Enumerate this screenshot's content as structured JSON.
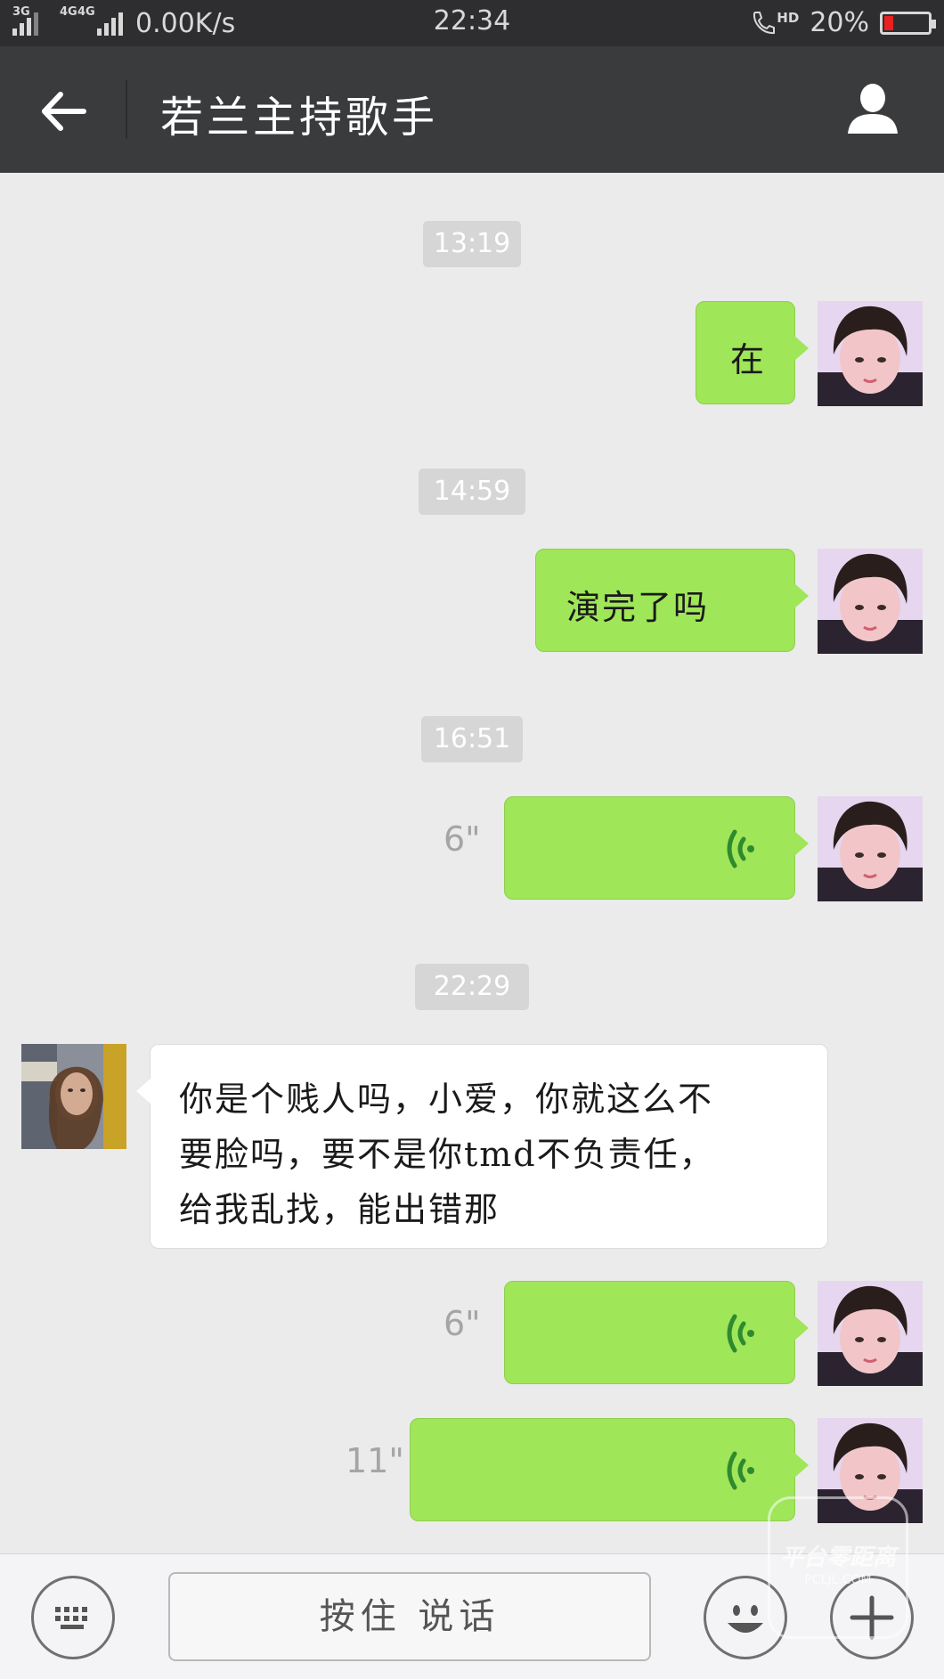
{
  "status_bar": {
    "net1": "3G",
    "net2": "4G",
    "net3": "4G",
    "speed": "0.00K/s",
    "time": "22:34",
    "call_label": "HD",
    "battery": "20%",
    "battery_level": 0.2,
    "battery_color": "#e82020"
  },
  "header": {
    "title": "若兰主持歌手"
  },
  "messages": [
    {
      "type": "timestamp",
      "text": "13:19"
    },
    {
      "type": "text",
      "sender": "me",
      "text": "在"
    },
    {
      "type": "timestamp",
      "text": "14:59"
    },
    {
      "type": "text",
      "sender": "me",
      "text": "演完了吗"
    },
    {
      "type": "timestamp",
      "text": "16:51"
    },
    {
      "type": "voice",
      "sender": "me",
      "duration": "6\""
    },
    {
      "type": "timestamp",
      "text": "22:29"
    },
    {
      "type": "text",
      "sender": "them",
      "lines": [
        "你是个贱人吗，小爱，你就这么不",
        "要脸吗，要不是你tmd不负责任，",
        "给我乱找，能出错那"
      ]
    },
    {
      "type": "voice",
      "sender": "me",
      "duration": "6\""
    },
    {
      "type": "voice",
      "sender": "me",
      "duration": "11\""
    }
  ],
  "bottom_bar": {
    "hold_to_talk": "按住 说话"
  },
  "watermark": {
    "text": "平台零距离",
    "sub": "PCLJL.COM"
  },
  "colors": {
    "my_bubble": "#9fe658",
    "their_bubble": "#ffffff",
    "header_bg": "#3a3b3d",
    "chat_bg": "#ebebeb"
  }
}
